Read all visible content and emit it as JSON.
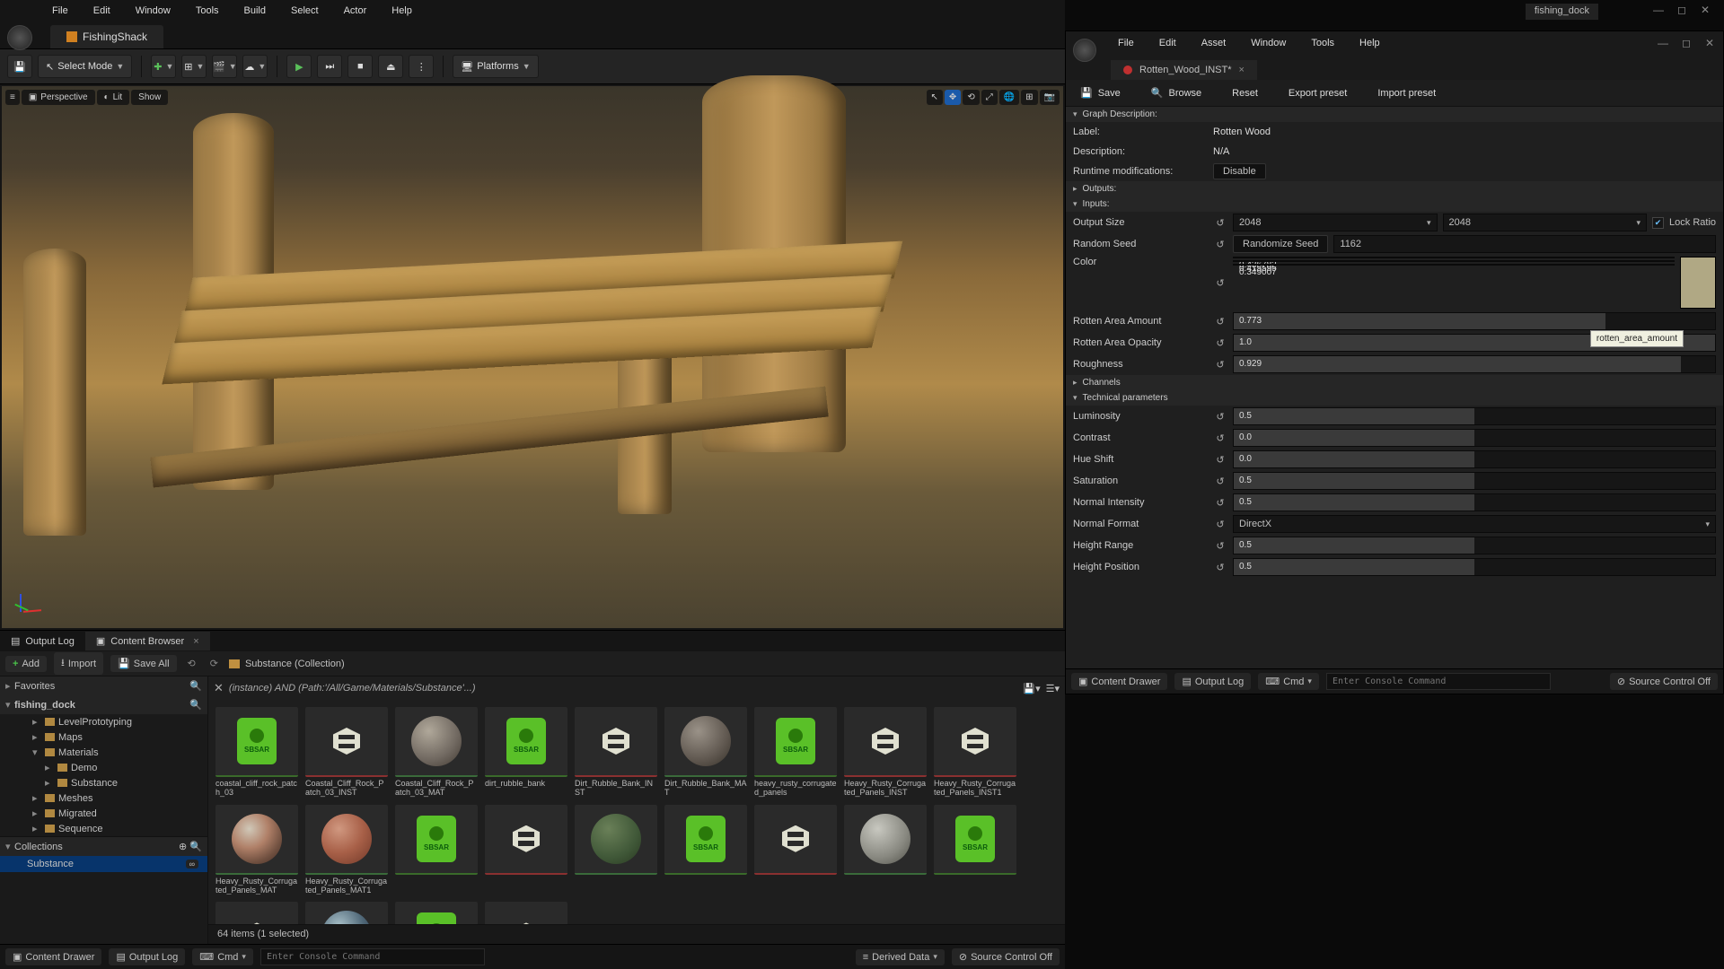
{
  "project_name": "fishing_dock",
  "main_menu": [
    "File",
    "Edit",
    "Window",
    "Tools",
    "Build",
    "Select",
    "Actor",
    "Help"
  ],
  "main_tab": "FishingShack",
  "toolbar": {
    "save_tip": "Save",
    "select_mode": "Select Mode",
    "platforms": "Platforms"
  },
  "viewport": {
    "hamburger": "≡",
    "perspective": "Perspective",
    "lit": "Lit",
    "show": "Show"
  },
  "bottom_tabs": {
    "output_log": "Output Log",
    "content_browser": "Content Browser"
  },
  "cb_toolbar": {
    "add": "Add",
    "import": "Import",
    "save_all": "Save All",
    "breadcrumb": "Substance (Collection)"
  },
  "cb_left": {
    "favorites": "Favorites",
    "root": "fishing_dock",
    "tree": {
      "level_proto": "LevelPrototyping",
      "maps": "Maps",
      "materials": "Materials",
      "demo": "Demo",
      "substance": "Substance",
      "meshes": "Meshes",
      "migrated": "Migrated",
      "sequence": "Sequence"
    },
    "collections": "Collections",
    "collection_item": "Substance",
    "coll_badge": "∞"
  },
  "cb_filter": "(instance) AND (Path:'/All/Game/Materials/Substance'...)",
  "assets_row1": [
    {
      "name": "coastal_cliff_rock_patch_03",
      "type": "sbsar"
    },
    {
      "name": "Coastal_Cliff_Rock_Patch_03_INST",
      "type": "inst"
    },
    {
      "name": "Coastal_Cliff_Rock_Patch_03_MAT",
      "type": "mat",
      "sphere": "rock"
    },
    {
      "name": "dirt_rubble_bank",
      "type": "sbsar"
    },
    {
      "name": "Dirt_Rubble_Bank_INST",
      "type": "inst"
    },
    {
      "name": "Dirt_Rubble_Bank_MAT",
      "type": "mat",
      "sphere": "dirt"
    },
    {
      "name": "heavy_rusty_corrugated_panels",
      "type": "sbsar"
    },
    {
      "name": "Heavy_Rusty_Corrugated_Panels_INST",
      "type": "inst"
    },
    {
      "name": "Heavy_Rusty_Corrugated_Panels_INST1",
      "type": "inst"
    },
    {
      "name": "Heavy_Rusty_Corrugated_Panels_MAT",
      "type": "mat",
      "sphere": "rusty"
    },
    {
      "name": "Heavy_Rusty_Corrugated_Panels_MAT1",
      "type": "mat",
      "sphere": "rusty2"
    }
  ],
  "assets_row2": [
    {
      "name": "",
      "type": "sbsar"
    },
    {
      "name": "",
      "type": "inst"
    },
    {
      "name": "",
      "type": "mat",
      "sphere": "moss"
    },
    {
      "name": "",
      "type": "sbsar"
    },
    {
      "name": "",
      "type": "inst"
    },
    {
      "name": "",
      "type": "mat",
      "sphere": "pebble"
    },
    {
      "name": "",
      "type": "sbsar"
    },
    {
      "name": "",
      "type": "inst"
    },
    {
      "name": "",
      "type": "mat",
      "sphere": "metal"
    },
    {
      "name": "",
      "type": "sbsar"
    },
    {
      "name": "",
      "type": "inst"
    }
  ],
  "cb_footer": "64 items (1 selected)",
  "bottomstrip": {
    "content_drawer": "Content Drawer",
    "output_log": "Output Log",
    "cmd": "Cmd",
    "cmd_placeholder": "Enter Console Command",
    "derived": "Derived Data",
    "source_control": "Source Control Off"
  },
  "sub": {
    "menu": [
      "File",
      "Edit",
      "Asset",
      "Window",
      "Tools",
      "Help"
    ],
    "tab": "Rotten_Wood_INST*",
    "toolbar": {
      "save": "Save",
      "browse": "Browse",
      "reset": "Reset",
      "export": "Export preset",
      "import": "Import preset"
    },
    "graph_section": "Graph Description:",
    "label_k": "Label:",
    "label_v": "Rotten Wood",
    "desc_k": "Description:",
    "desc_v": "N/A",
    "runtime_k": "Runtime modifications:",
    "runtime_v": "Disable",
    "outputs_section": "Outputs:",
    "inputs_section": "Inputs:",
    "output_size_k": "Output Size",
    "output_size_w": "2048",
    "output_size_h": "2048",
    "lock_ratio": "Lock Ratio",
    "random_seed_k": "Random Seed",
    "randomize_btn": "Randomize Seed",
    "random_seed_v": "1162",
    "color_k": "Color",
    "color_r": "0.436782",
    "color_g": "0.415595",
    "color_b": "0.349007",
    "rotten_amount_k": "Rotten Area Amount",
    "rotten_amount_v": "0.773",
    "rotten_opacity_k": "Rotten Area Opacity",
    "rotten_opacity_v": "1.0",
    "roughness_k": "Roughness",
    "roughness_v": "0.929",
    "tooltip": "rotten_area_amount",
    "channels_section": "Channels",
    "tech_section": "Technical parameters",
    "tech": {
      "luminosity_k": "Luminosity",
      "luminosity_v": "0.5",
      "contrast_k": "Contrast",
      "contrast_v": "0.0",
      "hue_k": "Hue Shift",
      "hue_v": "0.0",
      "saturation_k": "Saturation",
      "saturation_v": "0.5",
      "normal_int_k": "Normal Intensity",
      "normal_int_v": "0.5",
      "normal_fmt_k": "Normal Format",
      "normal_fmt_v": "DirectX",
      "height_range_k": "Height Range",
      "height_range_v": "0.5",
      "height_pos_k": "Height Position",
      "height_pos_v": "0.5"
    },
    "bottom": {
      "content_drawer": "Content Drawer",
      "output_log": "Output Log",
      "cmd": "Cmd",
      "cmd_placeholder": "Enter Console Command",
      "source_control": "Source Control Off"
    }
  }
}
